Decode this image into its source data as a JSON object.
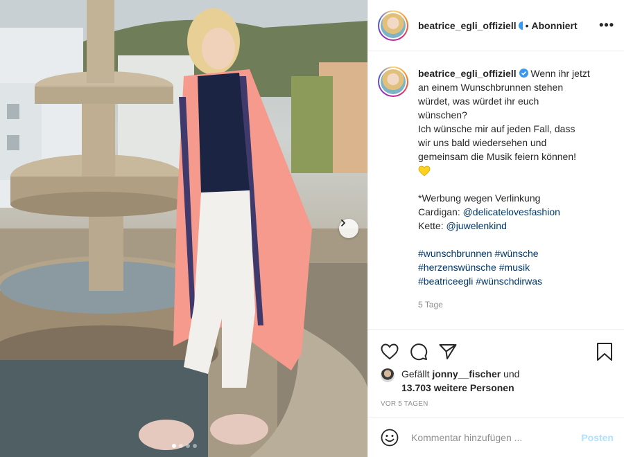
{
  "post": {
    "username": "beatrice_egli_offiziell",
    "header_separator": "•",
    "follow_status": "Abonniert",
    "more_glyph": "•••",
    "caption": {
      "username": "beatrice_egli_offiziell",
      "line1": "Wenn ihr jetzt",
      "line2": "an einem Wunschbrunnen stehen",
      "line3": "würdet, was würdet ihr euch",
      "line4": "wünschen?",
      "line5": "Ich wünsche mir auf jeden Fall, dass",
      "line6": "wir uns bald wiedersehen und",
      "line7": "gemeinsam die Musik feiern können!",
      "ad_note": "*Werbung wegen Verlinkung",
      "cardigan_label": "Cardigan:",
      "cardigan_mention": "@delicatelovesfashion",
      "chain_label": "Kette:",
      "chain_mention": "@juwelenkind",
      "tags": [
        "#wunschbrunnen",
        "#wünsche",
        "#herzenswünsche",
        "#musik",
        "#beatriceegli",
        "#wünschdirwas"
      ]
    },
    "time": "5 Tage",
    "likes": {
      "prefix": "Gefällt",
      "user": "jonny__fischer",
      "and": "und",
      "count": "13.703 weitere Personen"
    },
    "ago": "VOR 5 TAGEN"
  },
  "comment": {
    "placeholder": "Kommentar hinzufügen ...",
    "post_label": "Posten"
  },
  "carousel": {
    "total_slides": 4,
    "active_slide": 1
  },
  "colors": {
    "link": "#00376b",
    "muted": "#8e8e8e",
    "post_disabled": "#b2dffc",
    "verified": "#3897f0",
    "cardigan": "#f59a8c"
  },
  "icons": [
    "heart-icon",
    "comment-icon",
    "share-icon",
    "bookmark-icon",
    "emoji-icon",
    "chevron-right-icon",
    "verified-icon",
    "yellow-heart-emoji"
  ]
}
